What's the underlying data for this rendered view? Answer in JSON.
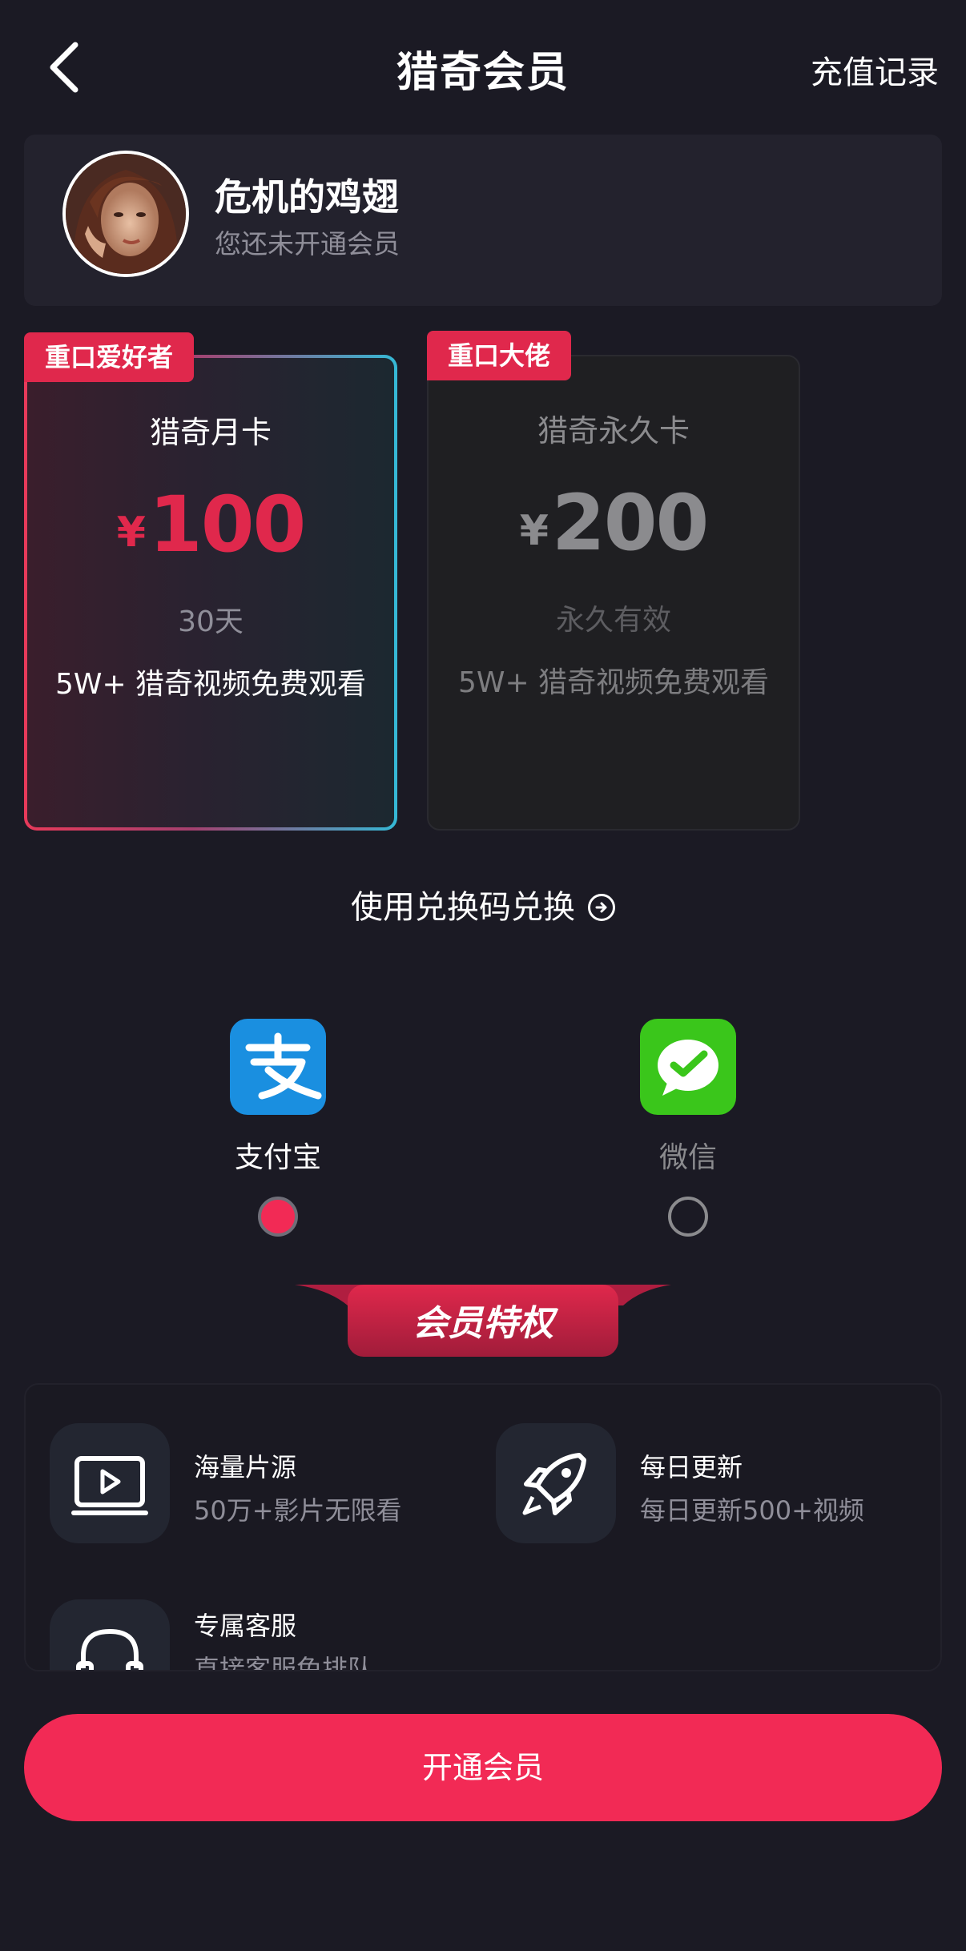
{
  "header": {
    "title": "猎奇会员",
    "history_label": "充值记录"
  },
  "user": {
    "name": "危机的鸡翅",
    "status": "您还未开通会员"
  },
  "plans": [
    {
      "badge": "重口爱好者",
      "name": "猎奇月卡",
      "currency": "¥",
      "price": "100",
      "duration": "30天",
      "feature": "5W+ 猎奇视频免费观看",
      "selected": true
    },
    {
      "badge": "重口大佬",
      "name": "猎奇永久卡",
      "currency": "¥",
      "price": "200",
      "duration": "永久有效",
      "feature": "5W+ 猎奇视频免费观看",
      "selected": false
    }
  ],
  "redeem": {
    "label": "使用兑换码兑换"
  },
  "payment": {
    "options": [
      {
        "label": "支付宝",
        "selected": true,
        "color": "#1a8fe0"
      },
      {
        "label": "微信",
        "selected": false,
        "color": "#3ac61b"
      }
    ]
  },
  "privileges": {
    "title": "会员特权",
    "items": [
      {
        "name": "海量片源",
        "desc": "50万+影片无限看",
        "icon": "video-icon"
      },
      {
        "name": "每日更新",
        "desc": "每日更新500+视频",
        "icon": "rocket-icon"
      },
      {
        "name": "专属客服",
        "desc": "直接客服免排队",
        "icon": "headset-icon"
      }
    ]
  },
  "cta": {
    "label": "开通会员"
  },
  "colors": {
    "accent": "#f22a55",
    "background": "#1b1a24"
  }
}
